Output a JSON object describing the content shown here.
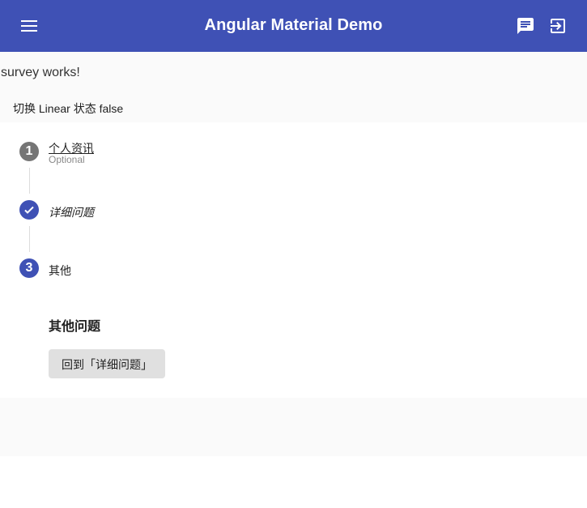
{
  "toolbar": {
    "title": "Angular Material Demo",
    "menu_icon": "menu-icon",
    "chat_icon": "chat-icon",
    "logout_icon": "exit-icon",
    "color": "#3f51b5"
  },
  "page": {
    "works_text": "survey works!",
    "toggle_label": "切换 Linear 状态 false"
  },
  "stepper": {
    "steps": [
      {
        "number": "1",
        "label": "个人资讯",
        "optional": "Optional",
        "state": "number",
        "color": "#757575"
      },
      {
        "number": "",
        "label": "详细问题",
        "state": "done",
        "icon": "check-icon",
        "color": "#3f51b5"
      },
      {
        "number": "3",
        "label": "其他",
        "state": "active",
        "color": "#3f51b5"
      }
    ],
    "active_content": {
      "title": "其他问题",
      "back_button": "回到「详细问题」"
    }
  }
}
